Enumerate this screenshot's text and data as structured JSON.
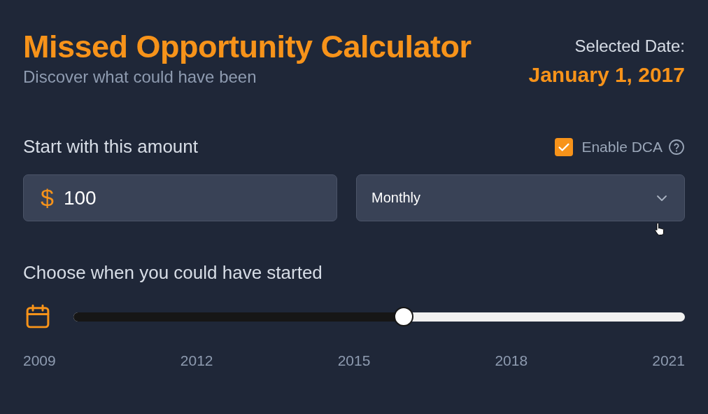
{
  "header": {
    "title": "Missed Opportunity Calculator",
    "subtitle": "Discover what could have been",
    "date_label": "Selected Date:",
    "date_value": "January 1, 2017"
  },
  "amount": {
    "label": "Start with this amount",
    "currency": "$",
    "value": "100"
  },
  "dca": {
    "label": "Enable DCA",
    "checked": true,
    "frequency": "Monthly"
  },
  "timeline": {
    "label": "Choose when you could have started",
    "level": 0.54,
    "ticks": [
      "2009",
      "2012",
      "2015",
      "2018",
      "2021"
    ]
  }
}
